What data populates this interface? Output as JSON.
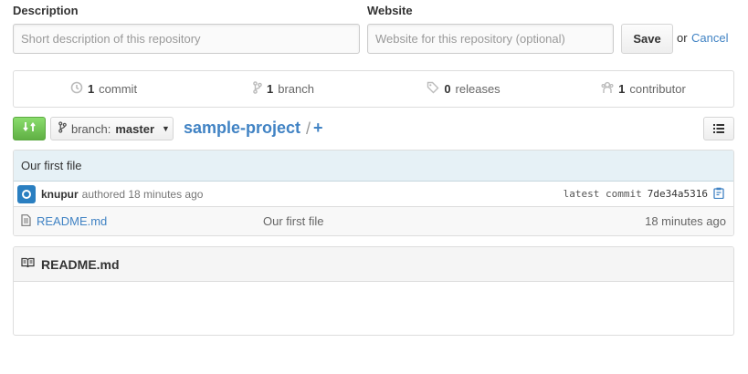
{
  "form": {
    "description_label": "Description",
    "description_placeholder": "Short description of this repository",
    "website_label": "Website",
    "website_placeholder": "Website for this repository (optional)",
    "save_label": "Save",
    "or_text": "or",
    "cancel_label": "Cancel"
  },
  "summary": {
    "commits_count": "1",
    "commits_label": "commit",
    "branches_count": "1",
    "branches_label": "branch",
    "releases_count": "0",
    "releases_label": "releases",
    "contributors_count": "1",
    "contributors_label": "contributor"
  },
  "toolbar": {
    "branch_prefix": "branch:",
    "branch_name": "master",
    "repo_name": "sample-project",
    "slash": "/",
    "plus": "+"
  },
  "latest_commit": {
    "message": "Our first file",
    "author": "knupur",
    "authored_text": "authored 18 minutes ago",
    "latest_label": "latest commit",
    "sha": "7de34a5316"
  },
  "files": [
    {
      "name": "README.md",
      "message": "Our first file",
      "age": "18 minutes ago"
    }
  ],
  "readme": {
    "title": "README.md"
  },
  "colors": {
    "link": "#4183c4",
    "green_button": "#60b044",
    "commit_bar": "#e6f1f6"
  }
}
